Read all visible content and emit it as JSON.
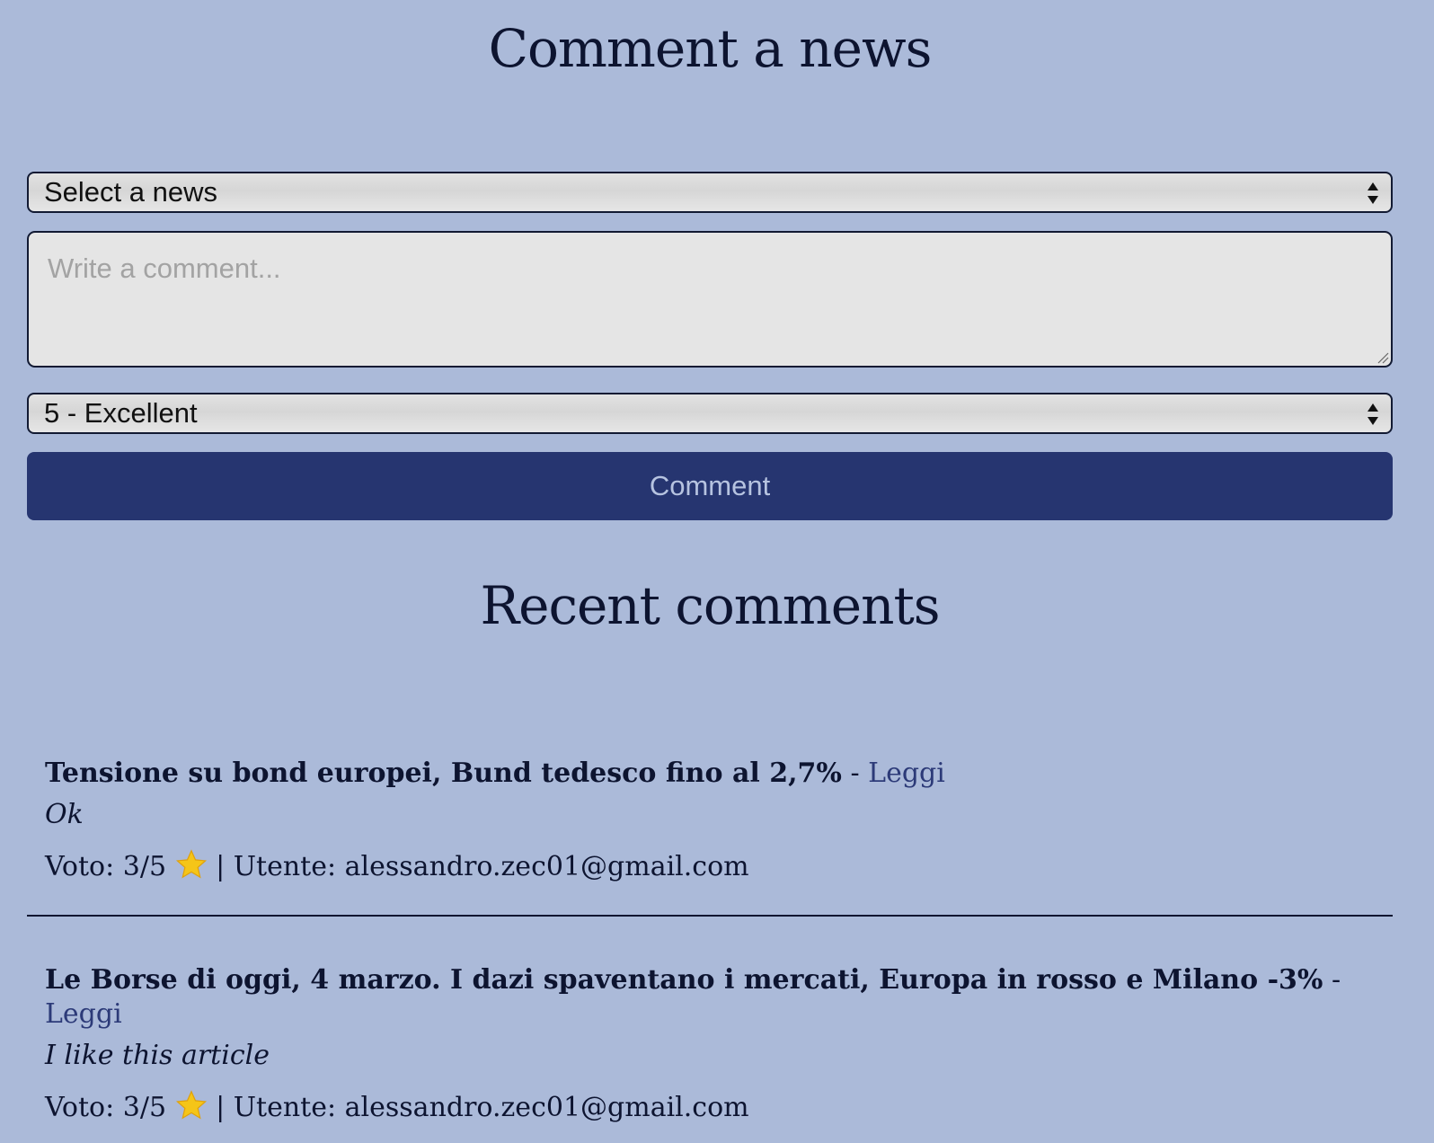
{
  "page": {
    "title": "Comment a news",
    "recent_title": "Recent comments"
  },
  "form": {
    "news_select": {
      "selected": "Select a news"
    },
    "comment_field": {
      "placeholder": "Write a comment..."
    },
    "rating_select": {
      "selected": "5 - Excellent"
    },
    "submit_label": "Comment"
  },
  "comments": [
    {
      "headline": "Tensione su bond europei, Bund tedesco fino al 2,7%",
      "separator": " - ",
      "link_label": "Leggi",
      "text": "Ok",
      "vote_label": "Voto:",
      "vote": "3/5",
      "user_label": "| Utente:",
      "user": "alessandro.zec01@gmail.com"
    },
    {
      "headline": "Le Borse di oggi, 4 marzo. I dazi spaventano i mercati, Europa in rosso e Milano -3%",
      "separator": " - ",
      "link_label": "Leggi",
      "text": "I like this article",
      "vote_label": "Voto:",
      "vote": "3/5",
      "user_label": "| Utente:",
      "user": "alessandro.zec01@gmail.com"
    }
  ],
  "colors": {
    "background": "#abbad9",
    "button": "#263570",
    "link": "#2c3a78",
    "star": "#f5c518"
  },
  "icons": {
    "select_arrows": "select-arrows-icon",
    "star": "star-icon",
    "resize_grip": "resize-grip-icon"
  }
}
